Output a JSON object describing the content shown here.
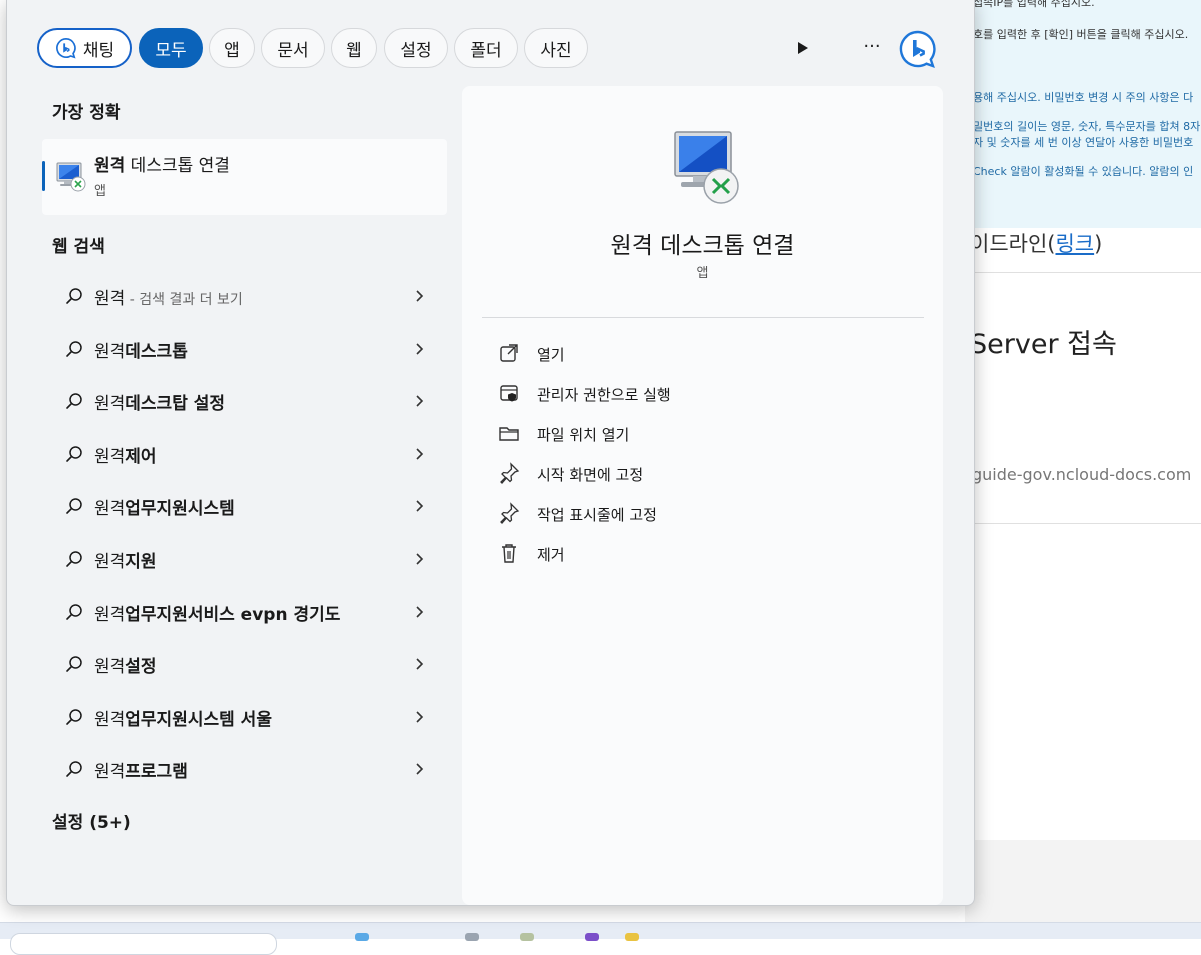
{
  "background_page": {
    "info_lines": [
      "접속IP를 입력해 주십시오.",
      "호를 입력한 후 [확인] 버튼을 클릭해 주십시오.",
      "용해 주십시오. 비밀번호 변경 시 주의 사항은 다",
      "밀번호의 길이는 영문, 숫자, 특수문자를 합쳐 8자",
      "자 및 숫자를 세 번 이상 연달아 사용한 비밀번호",
      "Check 알람이 활성화될 수 있습니다. 알람의 인"
    ],
    "guideline_prefix": "이드라인(",
    "guideline_link": "링크",
    "guideline_suffix": ")",
    "server_heading": "Server 접속",
    "url_fragment": "guide-gov.ncloud-docs.com"
  },
  "filters": {
    "chat_label": "채팅",
    "tabs": [
      "모두",
      "앱",
      "문서",
      "웹",
      "설정",
      "폴더",
      "사진"
    ],
    "active_tab": "모두",
    "more_label": "···"
  },
  "best_match": {
    "section_title": "가장 정확",
    "title_bold": "원격",
    "title_rest": " 데스크톱 연결",
    "subtitle": "앱"
  },
  "web_search": {
    "section_title": "웹 검색",
    "items": [
      {
        "prefix": "원격",
        "bold": "",
        "hint": " - 검색 결과 더 보기"
      },
      {
        "prefix": "원격",
        "bold": "데스크톱",
        "hint": ""
      },
      {
        "prefix": "원격",
        "bold": "데스크탑 설정",
        "hint": ""
      },
      {
        "prefix": "원격",
        "bold": "제어",
        "hint": ""
      },
      {
        "prefix": "원격",
        "bold": "업무지원시스템",
        "hint": ""
      },
      {
        "prefix": "원격",
        "bold": "지원",
        "hint": ""
      },
      {
        "prefix": "원격",
        "bold": "업무지원서비스 evpn 경기도",
        "hint": ""
      },
      {
        "prefix": "원격",
        "bold": "설정",
        "hint": ""
      },
      {
        "prefix": "원격",
        "bold": "업무지원시스템 서울",
        "hint": ""
      },
      {
        "prefix": "원격",
        "bold": "프로그램",
        "hint": ""
      }
    ]
  },
  "settings_section": {
    "title": "설정 (5+)"
  },
  "detail": {
    "title": "원격 데스크톱 연결",
    "subtitle": "앱",
    "actions": [
      {
        "label": "열기",
        "icon": "open-external-icon"
      },
      {
        "label": "관리자 권한으로 실행",
        "icon": "admin-shield-icon"
      },
      {
        "label": "파일 위치 열기",
        "icon": "folder-icon"
      },
      {
        "label": "시작 화면에 고정",
        "icon": "pin-icon"
      },
      {
        "label": "작업 표시줄에 고정",
        "icon": "pin-icon"
      },
      {
        "label": "제거",
        "icon": "trash-icon"
      }
    ]
  },
  "colors": {
    "accent": "#0b63ba",
    "chat_border": "#1561c8",
    "panel_bg": "#f1f3f5"
  }
}
